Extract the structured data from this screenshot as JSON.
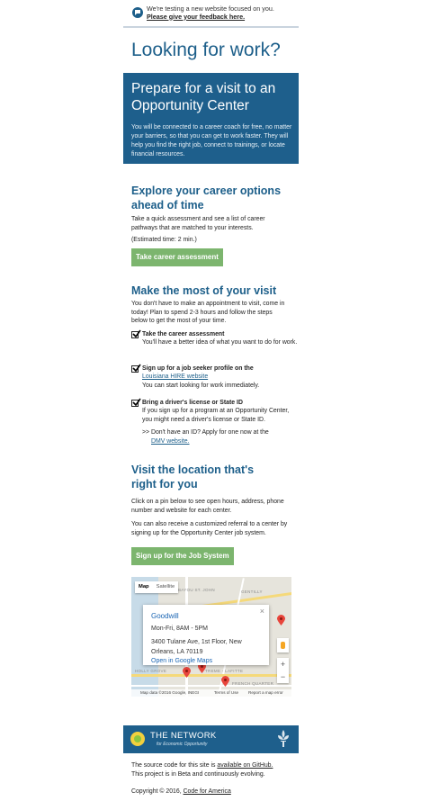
{
  "feedback": {
    "line1": "We're testing a new website focused on you.",
    "link": "Please give your feedback here."
  },
  "page_title": "Looking for work?",
  "hero": {
    "title": "Prepare for a visit to an Opportunity Center",
    "body": "You will be connected to a career coach for free, no matter your barriers, so that you can get to work faster. They will help you find the right job, connect to trainings, or locate financial resources."
  },
  "explore": {
    "heading": "Explore your career options ahead of time",
    "body": "Take a quick assessment and see a list of career pathways that are matched to your interests.",
    "estimate": "(Estimated time: 2 min.)",
    "button": "Take career assessment"
  },
  "visit": {
    "heading": "Make the most of your visit",
    "body": "You don't have to make an appointment to visit, come in today! Plan to spend 2-3 hours and follow the steps below to get the most of your time.",
    "steps": [
      {
        "title": "Take the career assessment",
        "desc": "You'll have a better idea of what you want to do for work."
      },
      {
        "title": "Sign up for a job seeker profile on the",
        "link": "Louisiana HIRE website",
        "desc": "You can start looking for work immediately."
      },
      {
        "title": "Bring a driver's license or State ID",
        "desc": "If you sign up for a program at an Opportunity Center, you might need a driver's license or State ID."
      }
    ],
    "id_note": ">> Don't have an ID? Apply for one now at the",
    "id_link": "DMV website."
  },
  "location": {
    "heading": "Visit the location that's right for you",
    "body1": "Click on a pin below to see open hours, address, phone number and website for each center.",
    "body2": "You can also receive a customized referral to a center by signing up for the Opportunity Center job system.",
    "button": "Sign up for the Job System"
  },
  "map": {
    "tabs": [
      "Map",
      "Satellite"
    ],
    "info": {
      "name": "Goodwill",
      "close": "×",
      "hours": "Mon-Fri, 8AM - 5PM",
      "address": "3400 Tulane Ave, 1st Floor, New Orleans, LA 70119",
      "link": "Open in Google Maps"
    },
    "zoom_in": "+",
    "zoom_out": "−",
    "labels": [
      "BAYOU ST. JOHN",
      "GENTILLY",
      "HOLLY GROVE",
      "TREME - LAFITTE",
      "FRENCH QUARTER"
    ],
    "footer": [
      "Map data ©2016 Google, INEGI",
      "Terms of Use",
      "Report a map error"
    ]
  },
  "network": {
    "title": "THE NETWORK",
    "subtitle": "for Economic Opportunity"
  },
  "footer": {
    "source_text": "The source code for this site is",
    "source_link": "available on GitHub.",
    "beta": "This project is in Beta and continuously evolving.",
    "copyright": "Copyright © 2016,",
    "cfa_link": "Code for America"
  }
}
